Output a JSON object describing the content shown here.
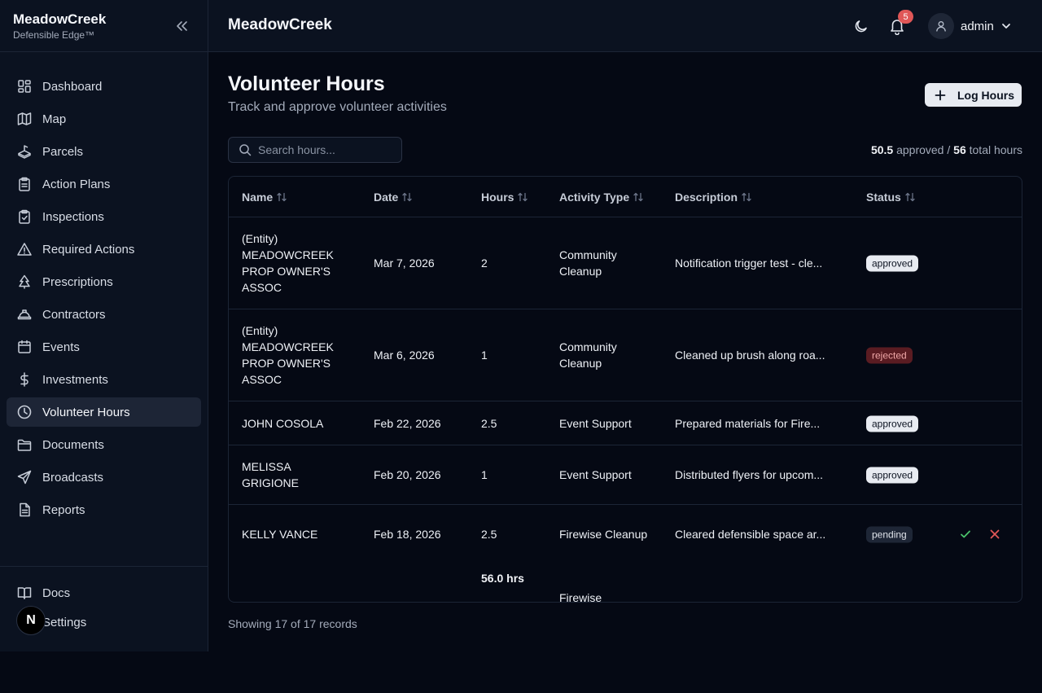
{
  "brand": {
    "name": "MeadowCreek",
    "tagline": "Defensible Edge™"
  },
  "sidebar": {
    "items": [
      {
        "label": "Dashboard",
        "icon": "dashboard-icon"
      },
      {
        "label": "Map",
        "icon": "map-icon"
      },
      {
        "label": "Parcels",
        "icon": "parcels-icon"
      },
      {
        "label": "Action Plans",
        "icon": "clipboard-icon"
      },
      {
        "label": "Inspections",
        "icon": "clipboard-check-icon"
      },
      {
        "label": "Required Actions",
        "icon": "alert-triangle-icon"
      },
      {
        "label": "Prescriptions",
        "icon": "tree-icon"
      },
      {
        "label": "Contractors",
        "icon": "hard-hat-icon"
      },
      {
        "label": "Events",
        "icon": "calendar-icon"
      },
      {
        "label": "Investments",
        "icon": "dollar-icon"
      },
      {
        "label": "Volunteer Hours",
        "icon": "clock-icon",
        "active": true
      },
      {
        "label": "Documents",
        "icon": "folder-icon"
      },
      {
        "label": "Broadcasts",
        "icon": "send-icon"
      },
      {
        "label": "Reports",
        "icon": "file-text-icon"
      }
    ],
    "footer": [
      {
        "label": "Docs",
        "icon": "book-icon"
      },
      {
        "label": "Settings",
        "icon": "settings-icon"
      }
    ],
    "n_badge": "N"
  },
  "header": {
    "title": "MeadowCreek",
    "notification_count": "5",
    "user": "admin"
  },
  "page": {
    "title": "Volunteer Hours",
    "subtitle": "Track and approve volunteer activities",
    "log_button": "Log Hours",
    "search_placeholder": "Search hours...",
    "summary": {
      "approved": "50.5",
      "approved_label": "approved /",
      "total": "56",
      "total_label": "total hours"
    }
  },
  "table": {
    "columns": [
      "Name",
      "Date",
      "Hours",
      "Activity Type",
      "Description",
      "Status"
    ],
    "rows": [
      {
        "name": "(Entity) MEADOWCREEK PROP OWNER'S ASSOC",
        "date": "Mar 7, 2026",
        "hours": "2",
        "type": "Community Cleanup",
        "desc": "Notification trigger test - cle...",
        "status": "approved"
      },
      {
        "name": "(Entity) MEADOWCREEK PROP OWNER'S ASSOC",
        "date": "Mar 6, 2026",
        "hours": "1",
        "type": "Community Cleanup",
        "desc": "Cleaned up brush along roa...",
        "status": "rejected"
      },
      {
        "name": "JOHN COSOLA",
        "date": "Feb 22, 2026",
        "hours": "2.5",
        "type": "Event Support",
        "desc": "Prepared materials for Fire...",
        "status": "approved"
      },
      {
        "name": "MELISSA GRIGIONE",
        "date": "Feb 20, 2026",
        "hours": "1",
        "type": "Event Support",
        "desc": "Distributed flyers for upcom...",
        "status": "approved"
      },
      {
        "name": "KELLY VANCE",
        "date": "Feb 18, 2026",
        "hours": "2.5",
        "type": "Firewise Cleanup",
        "desc": "Cleared defensible space ar...",
        "status": "pending"
      }
    ],
    "total_hours": "56.0 hrs",
    "cut_off_text": "Firewise",
    "footer": "Showing 17 of 17 records"
  },
  "colors": {
    "background": "#050914",
    "sidebar": "#0b1220",
    "approve": "#4bc26b",
    "reject": "#e05757"
  }
}
